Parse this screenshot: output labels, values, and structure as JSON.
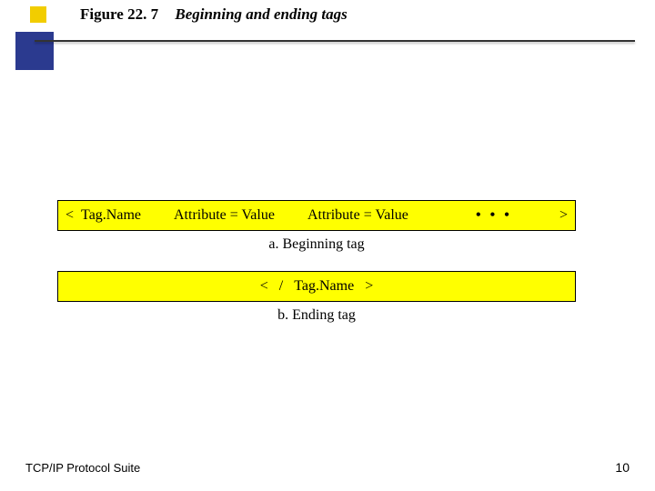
{
  "heading": {
    "fignum": "Figure 22. 7",
    "title": "Beginning and ending tags"
  },
  "begin_tag": {
    "lt": "<",
    "name": "Tag.Name",
    "attr1": "Attribute = Value",
    "attr2": "Attribute = Value",
    "dots": "• • •",
    "gt": ">"
  },
  "begin_caption": "a. Beginning tag",
  "end_tag": {
    "lt": "<",
    "slash": "/",
    "name": "Tag.Name",
    "gt": ">"
  },
  "end_caption": "b. Ending tag",
  "footer": {
    "left": "TCP/IP Protocol Suite",
    "page": "10"
  }
}
